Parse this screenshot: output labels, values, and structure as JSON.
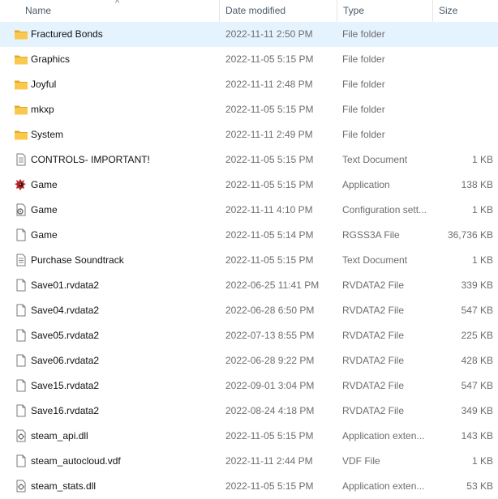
{
  "columns": {
    "name": "Name",
    "date": "Date modified",
    "type": "Type",
    "size": "Size"
  },
  "files": [
    {
      "name": "Fractured Bonds",
      "date": "2022-11-11 2:50 PM",
      "type": "File folder",
      "size": "",
      "icon": "folder-icon",
      "selected": true
    },
    {
      "name": "Graphics",
      "date": "2022-11-05 5:15 PM",
      "type": "File folder",
      "size": "",
      "icon": "folder-icon"
    },
    {
      "name": "Joyful",
      "date": "2022-11-11 2:48 PM",
      "type": "File folder",
      "size": "",
      "icon": "folder-icon"
    },
    {
      "name": "mkxp",
      "date": "2022-11-05 5:15 PM",
      "type": "File folder",
      "size": "",
      "icon": "folder-icon"
    },
    {
      "name": "System",
      "date": "2022-11-11 2:49 PM",
      "type": "File folder",
      "size": "",
      "icon": "folder-icon"
    },
    {
      "name": "CONTROLS- IMPORTANT!",
      "date": "2022-11-05 5:15 PM",
      "type": "Text Document",
      "size": "1 KB",
      "icon": "text-document-icon"
    },
    {
      "name": "Game",
      "date": "2022-11-05 5:15 PM",
      "type": "Application",
      "size": "138 KB",
      "icon": "game-app-icon"
    },
    {
      "name": "Game",
      "date": "2022-11-11 4:10 PM",
      "type": "Configuration sett...",
      "size": "1 KB",
      "icon": "config-settings-icon"
    },
    {
      "name": "Game",
      "date": "2022-11-05 5:14 PM",
      "type": "RGSS3A File",
      "size": "36,736 KB",
      "icon": "blank-file-icon"
    },
    {
      "name": "Purchase Soundtrack",
      "date": "2022-11-05 5:15 PM",
      "type": "Text Document",
      "size": "1 KB",
      "icon": "text-document-icon"
    },
    {
      "name": "Save01.rvdata2",
      "date": "2022-06-25 11:41 PM",
      "type": "RVDATA2 File",
      "size": "339 KB",
      "icon": "blank-file-icon"
    },
    {
      "name": "Save04.rvdata2",
      "date": "2022-06-28 6:50 PM",
      "type": "RVDATA2 File",
      "size": "547 KB",
      "icon": "blank-file-icon"
    },
    {
      "name": "Save05.rvdata2",
      "date": "2022-07-13 8:55 PM",
      "type": "RVDATA2 File",
      "size": "225 KB",
      "icon": "blank-file-icon"
    },
    {
      "name": "Save06.rvdata2",
      "date": "2022-06-28 9:22 PM",
      "type": "RVDATA2 File",
      "size": "428 KB",
      "icon": "blank-file-icon"
    },
    {
      "name": "Save15.rvdata2",
      "date": "2022-09-01 3:04 PM",
      "type": "RVDATA2 File",
      "size": "547 KB",
      "icon": "blank-file-icon"
    },
    {
      "name": "Save16.rvdata2",
      "date": "2022-08-24 4:18 PM",
      "type": "RVDATA2 File",
      "size": "349 KB",
      "icon": "blank-file-icon"
    },
    {
      "name": "steam_api.dll",
      "date": "2022-11-05 5:15 PM",
      "type": "Application exten...",
      "size": "143 KB",
      "icon": "dll-file-icon"
    },
    {
      "name": "steam_autocloud.vdf",
      "date": "2022-11-11 2:44 PM",
      "type": "VDF File",
      "size": "1 KB",
      "icon": "blank-file-icon"
    },
    {
      "name": "steam_stats.dll",
      "date": "2022-11-05 5:15 PM",
      "type": "Application exten...",
      "size": "53 KB",
      "icon": "dll-file-icon"
    }
  ],
  "colors": {
    "selection": "#e5f3ff",
    "folder": "#f8c94d",
    "folder_dark": "#e3a826"
  }
}
